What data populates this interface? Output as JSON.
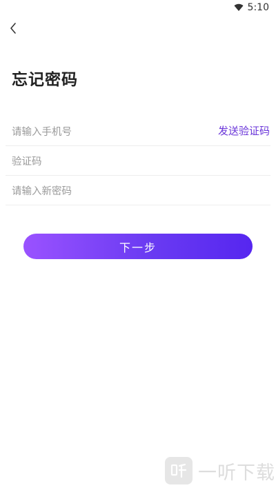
{
  "status_bar": {
    "time": "5:10",
    "wifi_icon": "wifi-icon"
  },
  "header": {
    "back_icon": "chevron-left-icon"
  },
  "page": {
    "title": "忘记密码"
  },
  "form": {
    "phone_placeholder": "请输入手机号",
    "send_code_label": "发送验证码",
    "code_placeholder": "验证码",
    "new_password_placeholder": "请输入新密码"
  },
  "actions": {
    "next_label": "下一步"
  },
  "colors": {
    "accent": "#6a35d9",
    "button_gradient_start": "#9a52ff",
    "button_gradient_end": "#5626f0"
  },
  "watermark": {
    "logo_icon": "yiting-logo-icon",
    "text": "一听下载"
  }
}
